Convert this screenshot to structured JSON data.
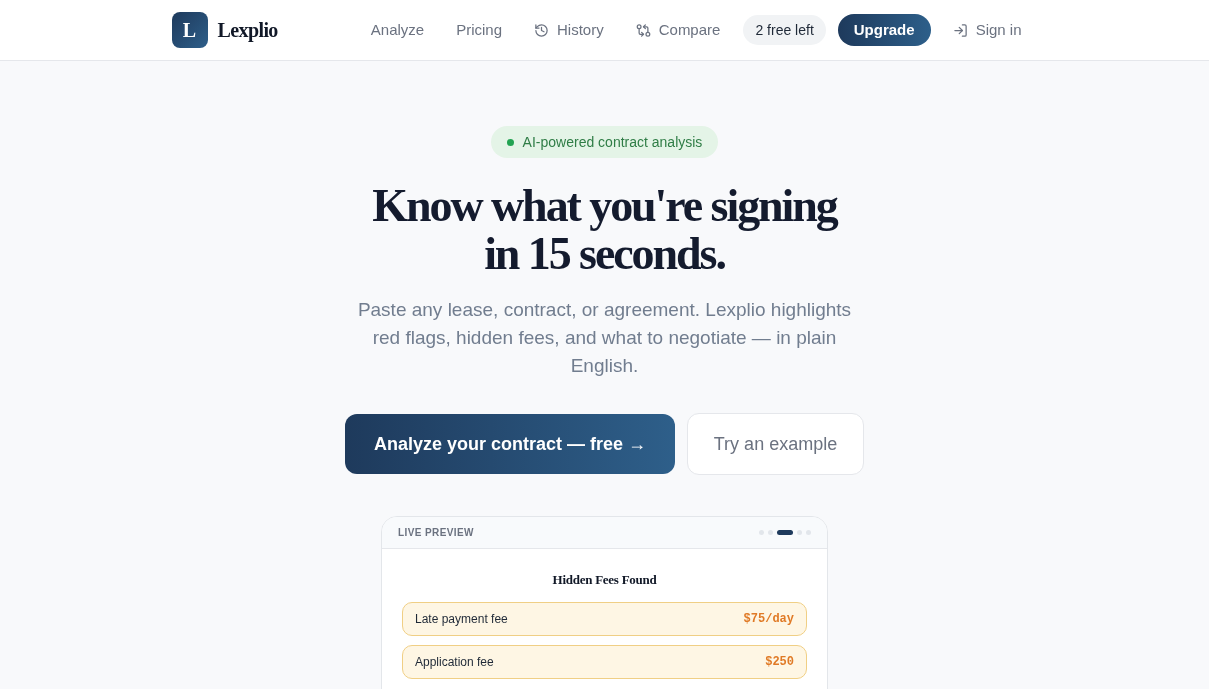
{
  "header": {
    "logo": {
      "letter": "L",
      "name": "Lexplio"
    },
    "nav": [
      {
        "label": "Analyze",
        "kind": "link"
      },
      {
        "label": "Pricing",
        "kind": "link"
      },
      {
        "label": "History",
        "kind": "history"
      },
      {
        "label": "Compare",
        "kind": "compare"
      }
    ],
    "credits_badge": "2 free left",
    "upgrade_button": "Upgrade",
    "sign_in": "Sign in"
  },
  "hero": {
    "badge": "AI-powered contract analysis",
    "headline": "Know what you're signing in 15 seconds.",
    "subtitle": "Paste any lease, contract, or agreement. Lexplio highlights red flags, hidden fees, and what to negotiate — in plain English.",
    "primary_button": "Analyze your contract — free →",
    "secondary_button": "Try an example"
  },
  "preview": {
    "label": "LIVE PREVIEW",
    "slides": [
      {
        "selected": false
      },
      {
        "selected": false
      },
      {
        "selected": true
      },
      {
        "selected": false
      },
      {
        "selected": false
      }
    ],
    "title": "Hidden Fees Found",
    "fees": [
      {
        "name": "Late payment fee",
        "amount": "$75/day"
      },
      {
        "name": "Application fee",
        "amount": "$250"
      }
    ]
  }
}
